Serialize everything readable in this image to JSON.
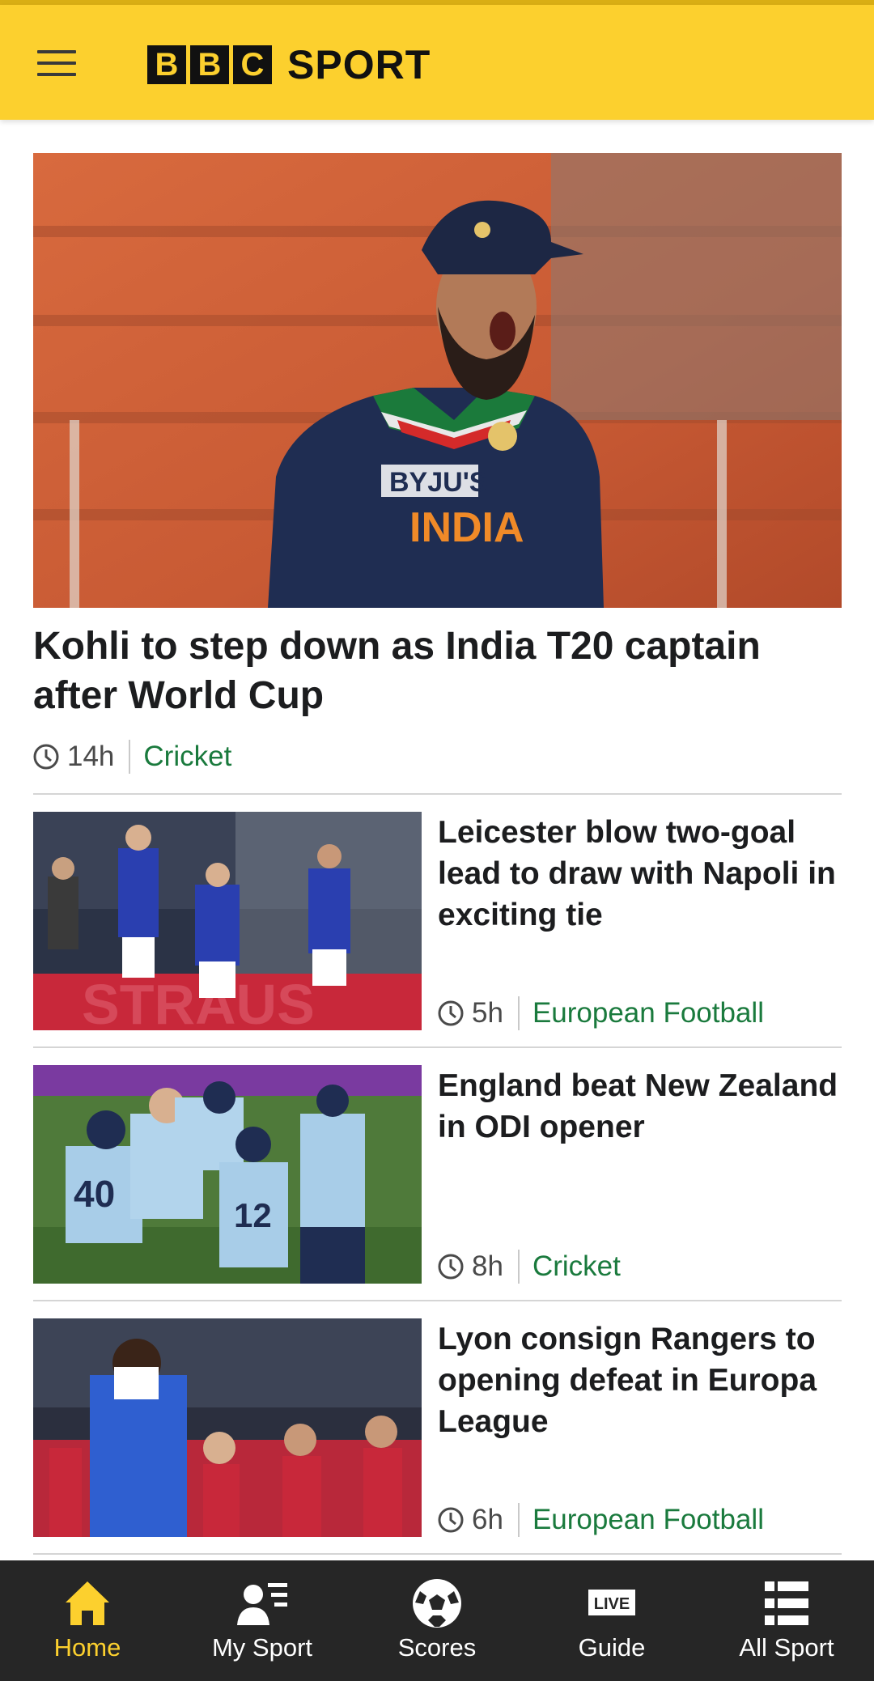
{
  "header": {
    "logo_letters": [
      "B",
      "B",
      "C"
    ],
    "logo_word": "SPORT",
    "brand_color": "#fcd02e"
  },
  "hero": {
    "image_icon": "cricket-player-photo",
    "title": "Kohli to step down as India T20 captain after World Cup",
    "time": "14h",
    "topic": "Cricket"
  },
  "stories": [
    {
      "image_icon": "football-players-photo",
      "title": "Leicester blow two-goal lead to draw with Napoli in exciting tie",
      "time": "5h",
      "topic": "European Football"
    },
    {
      "image_icon": "cricket-team-celebration-photo",
      "title": "England beat New Zealand in ODI opener",
      "time": "8h",
      "topic": "Cricket"
    },
    {
      "image_icon": "football-player-photo",
      "title": "Lyon consign Rangers to opening defeat in Europa League",
      "time": "6h",
      "topic": "European Football"
    }
  ],
  "nav": {
    "items": [
      {
        "label": "Home",
        "icon": "home-icon",
        "active": true
      },
      {
        "label": "My Sport",
        "icon": "my-sport-icon",
        "active": false
      },
      {
        "label": "Scores",
        "icon": "football-icon",
        "active": false
      },
      {
        "label": "Guide",
        "icon": "live-guide-icon",
        "active": false
      },
      {
        "label": "All Sport",
        "icon": "list-icon",
        "active": false
      }
    ]
  },
  "colors": {
    "topic_green": "#1a7a3d",
    "nav_background": "#262626",
    "active_tab": "#fcd02e"
  }
}
